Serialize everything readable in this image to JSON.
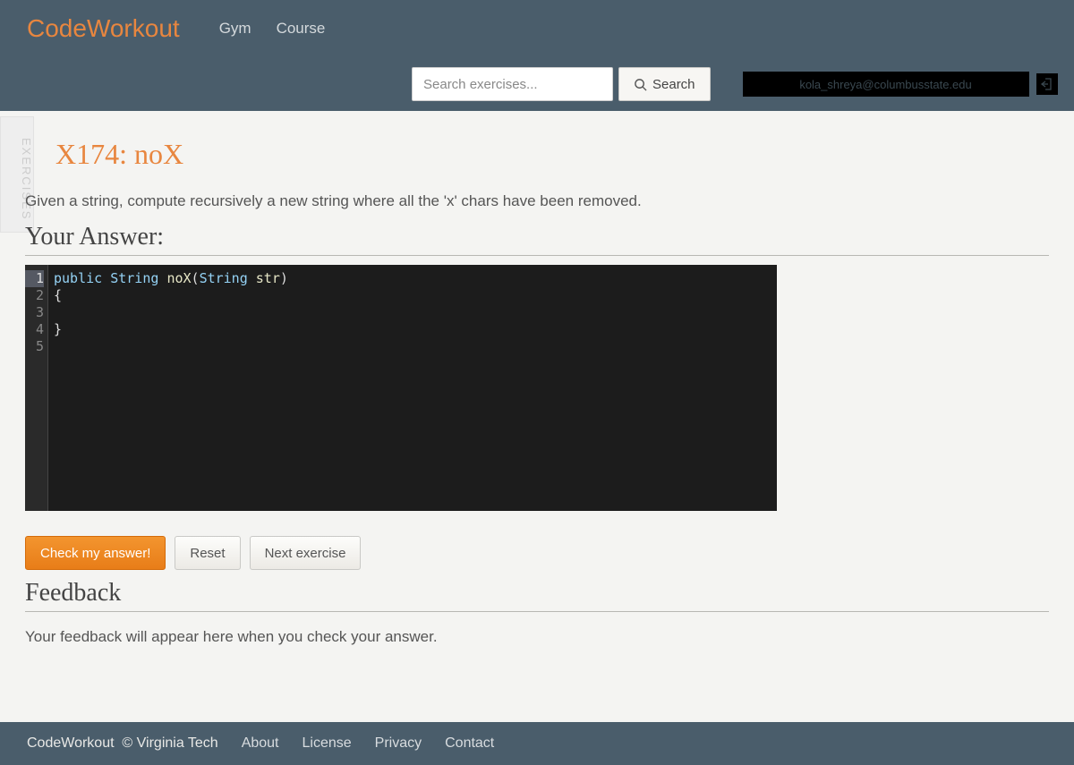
{
  "brand": "CodeWorkout",
  "nav": {
    "gym": "Gym",
    "course": "Course"
  },
  "search": {
    "placeholder": "Search exercises...",
    "button": "Search"
  },
  "user": {
    "masked": "kola_shreya@columbusstate.edu"
  },
  "sideTab": "EXERCISES",
  "exercise": {
    "title": "X174: noX",
    "description": "Given a string, compute recursively a new string where all the 'x' chars have been removed."
  },
  "answer": {
    "header": "Your Answer:",
    "code": {
      "lines": [
        "1",
        "2",
        "3",
        "4",
        "5"
      ],
      "l1_public": "public",
      "l1_type1": "String",
      "l1_name": "noX",
      "l1_paren_open": "(",
      "l1_type2": "String",
      "l1_param": "str",
      "l1_paren_close": ")",
      "l2": "{",
      "l4": "}"
    }
  },
  "buttons": {
    "check": "Check my answer!",
    "reset": "Reset",
    "next": "Next exercise"
  },
  "feedback": {
    "header": "Feedback",
    "text": "Your feedback will appear here when you check your answer."
  },
  "footer": {
    "brand": "CodeWorkout",
    "copyright": "© Virginia Tech",
    "about": "About",
    "license": "License",
    "privacy": "Privacy",
    "contact": "Contact"
  }
}
